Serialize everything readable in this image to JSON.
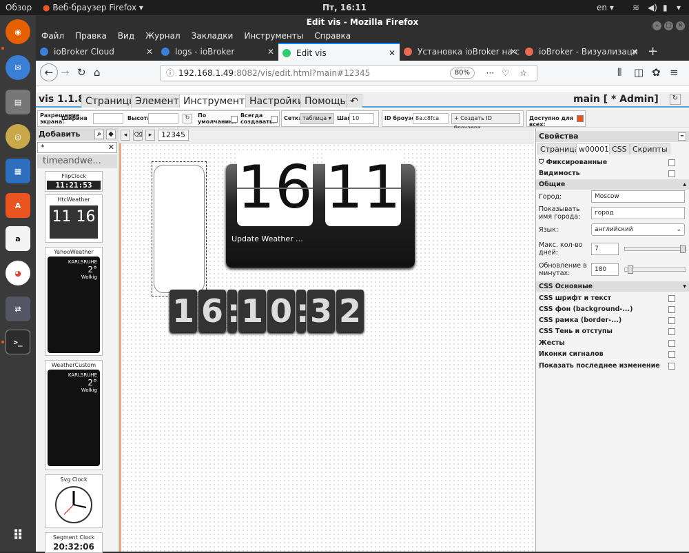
{
  "os": {
    "activities": "Обзор",
    "app_menu": "Веб-браузер Firefox",
    "clock": "Пт, 16:11",
    "lang": "en"
  },
  "browser": {
    "window_title": "Edit vis - Mozilla Firefox",
    "menu": [
      "Файл",
      "Правка",
      "Вид",
      "Журнал",
      "Закладки",
      "Инструменты",
      "Справка"
    ],
    "tabs": [
      {
        "label": "ioBroker Cloud"
      },
      {
        "label": "logs - ioBroker"
      },
      {
        "label": "Edit vis"
      },
      {
        "label": "Установка ioBroker на с"
      },
      {
        "label": "ioBroker - Визуализаци"
      }
    ],
    "url_host": "192.168.1.49",
    "url_rest": ":8082/vis/edit.html?main#12345",
    "zoom": "80%"
  },
  "app": {
    "version": "vis 1.1.8",
    "tabs": [
      "Страницы",
      "Элементы",
      "Инструменты",
      "Настройки",
      "Помощь"
    ],
    "view_info": "main [ * Admin]",
    "toolbar": {
      "resolution": "Разрешение экрана:",
      "width": "Ширина",
      "height": "Высота",
      "default": "По умолчанию:",
      "always_create": "Всегда создавать:",
      "grid": "Сетка",
      "grid_value": "таблица",
      "step": "Шаг:",
      "step_value": "10",
      "browser_id": "ID броузера",
      "browser_id_value": "8a.c8fca",
      "create_id": "Создать ID броузера",
      "available_all": "Доступно для всех:"
    }
  },
  "widgets_panel": {
    "title": "Добавить",
    "filter": "*",
    "set": "timeandwe...",
    "cards": [
      "FlipClock",
      "HtcWeather",
      "YahooWeather",
      "WeatherCustom",
      "Svg Clock",
      "Segment Clock"
    ],
    "flip_preview": "11:21:53",
    "htc_preview": "11 16",
    "segment_preview": "20:32:06",
    "weather_city": "KARLSRUHE",
    "weather_temp": "2°",
    "weather_cond": "Wolkig"
  },
  "editor": {
    "view_name": "12345",
    "flip_hours": "16",
    "flip_minutes": "11",
    "weather_text": "Update Weather ...",
    "seg_time": [
      "1",
      "6",
      ":",
      "1",
      "0",
      ":",
      "3",
      "2"
    ]
  },
  "props": {
    "title": "Свойства",
    "tabs": [
      "Страница",
      "w00001",
      "CSS",
      "Скрипты"
    ],
    "fixed": "Фиксированные",
    "visibility": "Видимость",
    "common": "Общие",
    "city_label": "Город:",
    "city_value": "Moscow",
    "show_city_label": "Показывать имя города:",
    "show_city_value": "город",
    "lang_label": "Язык:",
    "lang_value": "английский",
    "days_label": "Макс. кол-во дней:",
    "days_value": "7",
    "update_label": "Обновление в минутах:",
    "update_value": "180",
    "css_sections": [
      "CSS Основные",
      "CSS шрифт и текст",
      "CSS фон (background-...)",
      "CSS рамка (border-...)",
      "CSS Тень и отступы",
      "Жесты",
      "Иконки сигналов",
      "Показать последнее изменение"
    ]
  },
  "colors": {
    "accent": "#0a84ff",
    "vis_blue": "#4aa3df",
    "ubuntu_orange": "#e95420"
  }
}
